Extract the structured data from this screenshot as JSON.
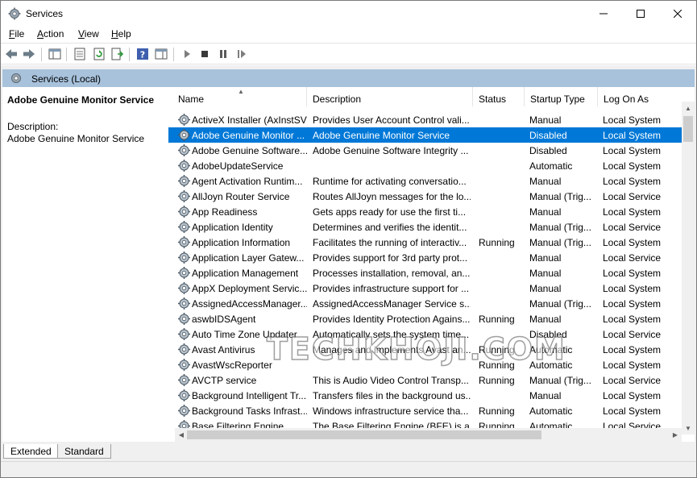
{
  "window": {
    "title": "Services"
  },
  "menu": [
    "File",
    "Action",
    "View",
    "Help"
  ],
  "scope": {
    "label": "Services (Local)"
  },
  "details": {
    "service_name": "Adobe Genuine Monitor Service",
    "description_label": "Description:",
    "description_text": "Adobe Genuine Monitor Service"
  },
  "columns": [
    "Name",
    "Description",
    "Status",
    "Startup Type",
    "Log On As"
  ],
  "services": [
    {
      "name": "ActiveX Installer (AxInstSV)",
      "description": "Provides User Account Control vali...",
      "status": "",
      "startup": "Manual",
      "logon": "Local System"
    },
    {
      "name": "Adobe Genuine Monitor ...",
      "description": "Adobe Genuine Monitor Service",
      "status": "",
      "startup": "Disabled",
      "logon": "Local System"
    },
    {
      "name": "Adobe Genuine Software...",
      "description": "Adobe Genuine Software Integrity ...",
      "status": "",
      "startup": "Disabled",
      "logon": "Local System"
    },
    {
      "name": "AdobeUpdateService",
      "description": "",
      "status": "",
      "startup": "Automatic",
      "logon": "Local System"
    },
    {
      "name": "Agent Activation Runtim...",
      "description": "Runtime for activating conversatio...",
      "status": "",
      "startup": "Manual",
      "logon": "Local System"
    },
    {
      "name": "AllJoyn Router Service",
      "description": "Routes AllJoyn messages for the lo...",
      "status": "",
      "startup": "Manual (Trig...",
      "logon": "Local Service"
    },
    {
      "name": "App Readiness",
      "description": "Gets apps ready for use the first ti...",
      "status": "",
      "startup": "Manual",
      "logon": "Local System"
    },
    {
      "name": "Application Identity",
      "description": "Determines and verifies the identit...",
      "status": "",
      "startup": "Manual (Trig...",
      "logon": "Local Service"
    },
    {
      "name": "Application Information",
      "description": "Facilitates the running of interactiv...",
      "status": "Running",
      "startup": "Manual (Trig...",
      "logon": "Local System"
    },
    {
      "name": "Application Layer Gatew...",
      "description": "Provides support for 3rd party prot...",
      "status": "",
      "startup": "Manual",
      "logon": "Local Service"
    },
    {
      "name": "Application Management",
      "description": "Processes installation, removal, an...",
      "status": "",
      "startup": "Manual",
      "logon": "Local System"
    },
    {
      "name": "AppX Deployment Servic...",
      "description": "Provides infrastructure support for ...",
      "status": "",
      "startup": "Manual",
      "logon": "Local System"
    },
    {
      "name": "AssignedAccessManager...",
      "description": "AssignedAccessManager Service s...",
      "status": "",
      "startup": "Manual (Trig...",
      "logon": "Local System"
    },
    {
      "name": "aswbIDSAgent",
      "description": "Provides Identity Protection Agains...",
      "status": "Running",
      "startup": "Manual",
      "logon": "Local System"
    },
    {
      "name": "Auto Time Zone Updater",
      "description": "Automatically sets the system time...",
      "status": "",
      "startup": "Disabled",
      "logon": "Local Service"
    },
    {
      "name": "Avast Antivirus",
      "description": "Manages and implements Avast an...",
      "status": "Running",
      "startup": "Automatic",
      "logon": "Local System"
    },
    {
      "name": "AvastWscReporter",
      "description": "",
      "status": "Running",
      "startup": "Automatic",
      "logon": "Local System"
    },
    {
      "name": "AVCTP service",
      "description": "This is Audio Video Control Transp...",
      "status": "Running",
      "startup": "Manual (Trig...",
      "logon": "Local Service"
    },
    {
      "name": "Background Intelligent Tr...",
      "description": "Transfers files in the background us...",
      "status": "",
      "startup": "Manual",
      "logon": "Local System"
    },
    {
      "name": "Background Tasks Infrast...",
      "description": "Windows infrastructure service tha...",
      "status": "Running",
      "startup": "Automatic",
      "logon": "Local System"
    },
    {
      "name": "Base Filtering Engine",
      "description": "The Base Filtering Engine (BFE) is a ...",
      "status": "Running",
      "startup": "Automatic",
      "logon": "Local Service"
    }
  ],
  "selected_index": 1,
  "tabs": [
    "Extended",
    "Standard"
  ],
  "watermark": "TECHKHOJI.COM",
  "colors": {
    "selection": "#0078d7",
    "scope_header": "#a8c2dc"
  },
  "icons": [
    "services-gear-icon",
    "back-arrow-icon",
    "forward-arrow-icon",
    "show-hide-console-tree-icon",
    "properties-icon",
    "refresh-icon",
    "export-list-icon",
    "help-icon",
    "show-hide-action-pane-icon",
    "play-icon",
    "stop-icon",
    "pause-icon",
    "restart-icon"
  ]
}
